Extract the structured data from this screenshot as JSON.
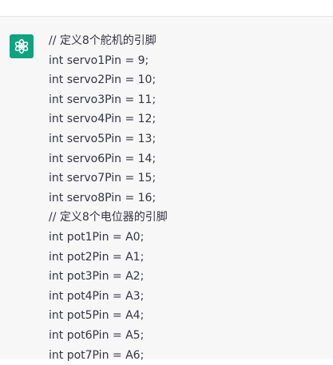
{
  "assistant": {
    "avatar_icon": "openai-logo-icon",
    "avatar_color": "#10a37f",
    "lines": [
      "// 定义8个舵机的引脚",
      "int servo1Pin = 9;",
      "int servo2Pin = 10;",
      "int servo3Pin = 11;",
      "int servo4Pin = 12;",
      "int servo5Pin = 13;",
      "int servo6Pin = 14;",
      "int servo7Pin = 15;",
      "int servo8Pin = 16;",
      "// 定义8个电位器的引脚",
      "int pot1Pin = A0;",
      "int pot2Pin = A1;",
      "int pot3Pin = A2;",
      "int pot4Pin = A3;",
      "int pot5Pin = A4;",
      "int pot6Pin = A5;",
      "int pot7Pin = A6;"
    ]
  }
}
